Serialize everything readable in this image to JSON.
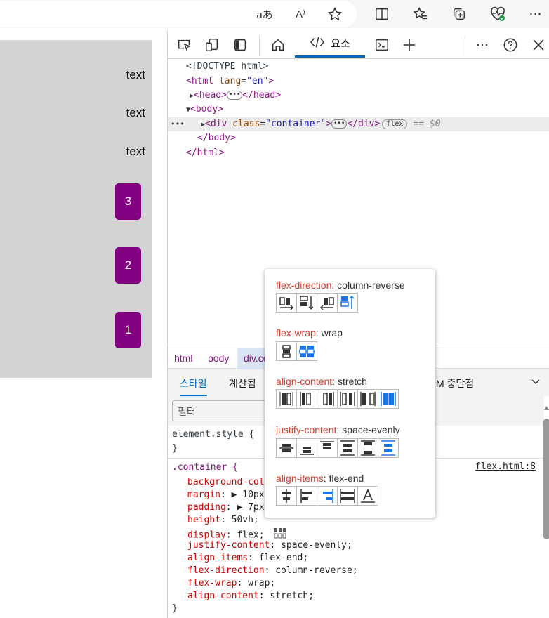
{
  "browser": {
    "toolbar_icons": [
      "read-aloud-translate-icon",
      "read-aloud-icon",
      "favorite-star-icon",
      "split-screen-icon",
      "favorites-icon",
      "collections-icon",
      "browser-essentials-icon",
      "more-icon"
    ],
    "translate_glyph": "aあ",
    "read_aloud_glyph": "A⁾"
  },
  "preview": {
    "texts": [
      "text",
      "text",
      "text"
    ],
    "boxes": [
      "3",
      "2",
      "1"
    ],
    "box_color": "#800080",
    "background": "#d3d3d4"
  },
  "devtools": {
    "tab_elements_label": "요소",
    "dom": {
      "doctype": "<!DOCTYPE html>",
      "html_open_tag": "<html",
      "html_lang_attr": "lang",
      "html_lang_val": "\"en\"",
      "gt": ">",
      "head_open": "<head>",
      "head_close": "</head>",
      "body_open": "<body>",
      "div_open": "<div",
      "div_class_attr": "class",
      "div_class_val": "\"container\"",
      "div_close": "</div>",
      "flex_badge": "flex",
      "eq_ref": "== $0",
      "body_close": "</body>",
      "html_close": "</html>",
      "ellipsis": "•••",
      "row_ellipsis": "•••"
    },
    "breadcrumbs": [
      "html",
      "body",
      "div.co"
    ],
    "subtabs": {
      "styles": "스타일",
      "computed": "계산됨",
      "dom_breakpoints": "M 중단점"
    },
    "filter_placeholder": "필터",
    "styles": {
      "element_style": "element.style {",
      "close_brace": "}",
      "container_selector": ".container {",
      "source_link": "flex.html:8",
      "props": [
        {
          "name": "background-col",
          "value": ""
        },
        {
          "name": "margin",
          "value": "▶ 10px"
        },
        {
          "name": "padding",
          "value": "▶ 7px"
        },
        {
          "name": "height",
          "value": "50vh;"
        },
        {
          "name": "display",
          "value": "flex;"
        },
        {
          "name": "justify-content",
          "value": "space-evenly;"
        },
        {
          "name": "align-items",
          "value": "flex-end;"
        },
        {
          "name": "flex-direction",
          "value": "column-reverse;"
        },
        {
          "name": "flex-wrap",
          "value": "wrap;"
        },
        {
          "name": "align-content",
          "value": "stretch;"
        }
      ]
    }
  },
  "flex_popup": {
    "sections": [
      {
        "key": "flex-direction",
        "value": "column-reverse",
        "buttons": 4,
        "active": 3
      },
      {
        "key": "flex-wrap",
        "value": "wrap",
        "buttons": 2,
        "active": 1
      },
      {
        "key": "align-content",
        "value": "stretch",
        "buttons": 6,
        "active": 5
      },
      {
        "key": "justify-content",
        "value": "space-evenly",
        "buttons": 6,
        "active": 5
      },
      {
        "key": "align-items",
        "value": "flex-end",
        "buttons": 5,
        "active": 2
      }
    ],
    "active_color": "#1a73e8",
    "key_color": "#d33a2c"
  }
}
